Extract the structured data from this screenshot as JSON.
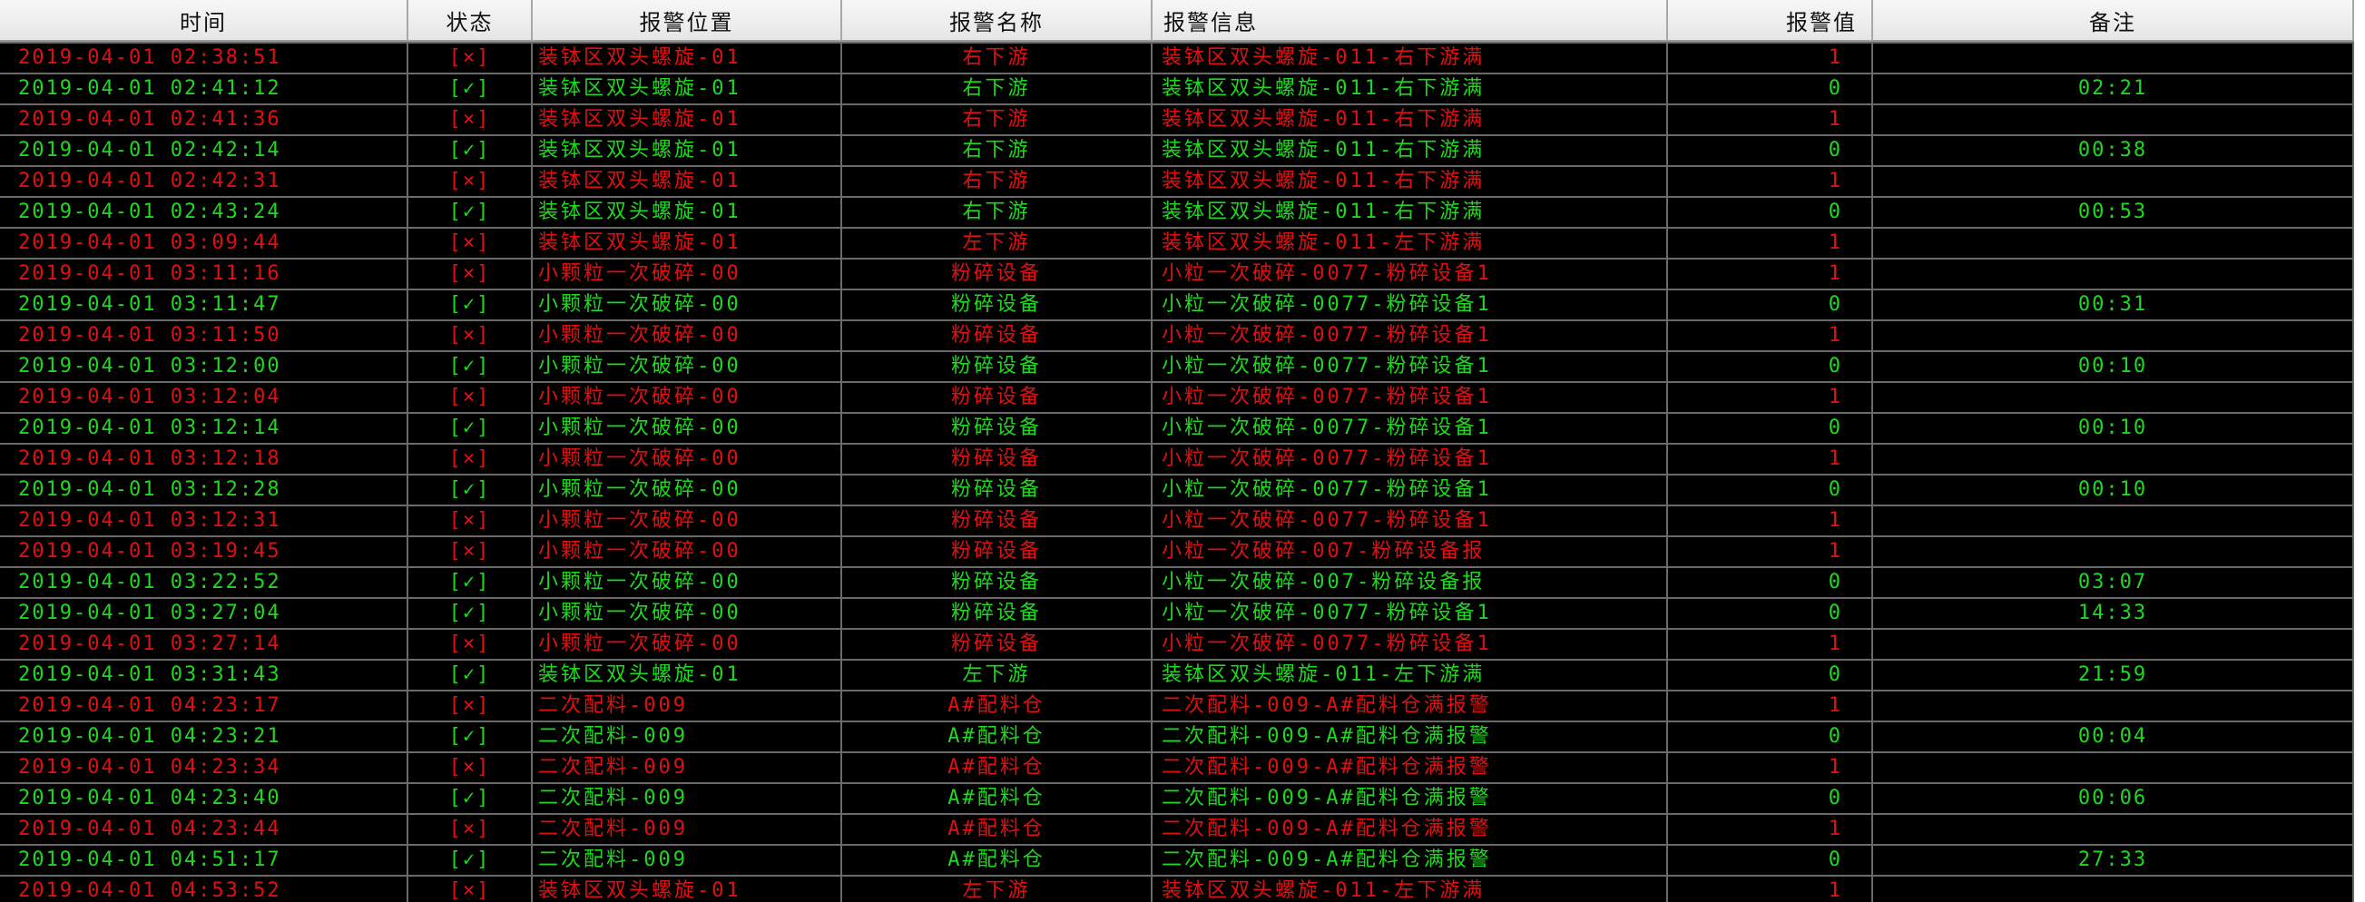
{
  "headers": [
    "时间",
    "状态",
    "报警位置",
    "报警名称",
    "报警信息",
    "报警值",
    "备注"
  ],
  "colors": {
    "alarm": "#e01010",
    "recovered": "#1fd81f"
  },
  "rows": [
    {
      "time": "2019-04-01  02:38:51",
      "status": "[×]",
      "location": "装钵区双头螺旋-01",
      "name": "右下游",
      "info": "装钵区双头螺旋-011-右下游满",
      "value": "1",
      "note": "",
      "state": "alarm"
    },
    {
      "time": "2019-04-01  02:41:12",
      "status": "[✓]",
      "location": "装钵区双头螺旋-01",
      "name": "右下游",
      "info": "装钵区双头螺旋-011-右下游满",
      "value": "0",
      "note": "02:21",
      "state": "recovered"
    },
    {
      "time": "2019-04-01  02:41:36",
      "status": "[×]",
      "location": "装钵区双头螺旋-01",
      "name": "右下游",
      "info": "装钵区双头螺旋-011-右下游满",
      "value": "1",
      "note": "",
      "state": "alarm"
    },
    {
      "time": "2019-04-01  02:42:14",
      "status": "[✓]",
      "location": "装钵区双头螺旋-01",
      "name": "右下游",
      "info": "装钵区双头螺旋-011-右下游满",
      "value": "0",
      "note": "00:38",
      "state": "recovered"
    },
    {
      "time": "2019-04-01  02:42:31",
      "status": "[×]",
      "location": "装钵区双头螺旋-01",
      "name": "右下游",
      "info": "装钵区双头螺旋-011-右下游满",
      "value": "1",
      "note": "",
      "state": "alarm"
    },
    {
      "time": "2019-04-01  02:43:24",
      "status": "[✓]",
      "location": "装钵区双头螺旋-01",
      "name": "右下游",
      "info": "装钵区双头螺旋-011-右下游满",
      "value": "0",
      "note": "00:53",
      "state": "recovered"
    },
    {
      "time": "2019-04-01  03:09:44",
      "status": "[×]",
      "location": "装钵区双头螺旋-01",
      "name": "左下游",
      "info": "装钵区双头螺旋-011-左下游满",
      "value": "1",
      "note": "",
      "state": "alarm"
    },
    {
      "time": "2019-04-01  03:11:16",
      "status": "[×]",
      "location": "小颗粒一次破碎-00",
      "name": "粉碎设备",
      "info": "小粒一次破碎-0077-粉碎设备1",
      "value": "1",
      "note": "",
      "state": "alarm"
    },
    {
      "time": "2019-04-01  03:11:47",
      "status": "[✓]",
      "location": "小颗粒一次破碎-00",
      "name": "粉碎设备",
      "info": "小粒一次破碎-0077-粉碎设备1",
      "value": "0",
      "note": "00:31",
      "state": "recovered"
    },
    {
      "time": "2019-04-01  03:11:50",
      "status": "[×]",
      "location": "小颗粒一次破碎-00",
      "name": "粉碎设备",
      "info": "小粒一次破碎-0077-粉碎设备1",
      "value": "1",
      "note": "",
      "state": "alarm"
    },
    {
      "time": "2019-04-01  03:12:00",
      "status": "[✓]",
      "location": "小颗粒一次破碎-00",
      "name": "粉碎设备",
      "info": "小粒一次破碎-0077-粉碎设备1",
      "value": "0",
      "note": "00:10",
      "state": "recovered"
    },
    {
      "time": "2019-04-01  03:12:04",
      "status": "[×]",
      "location": "小颗粒一次破碎-00",
      "name": "粉碎设备",
      "info": "小粒一次破碎-0077-粉碎设备1",
      "value": "1",
      "note": "",
      "state": "alarm"
    },
    {
      "time": "2019-04-01  03:12:14",
      "status": "[✓]",
      "location": "小颗粒一次破碎-00",
      "name": "粉碎设备",
      "info": "小粒一次破碎-0077-粉碎设备1",
      "value": "0",
      "note": "00:10",
      "state": "recovered"
    },
    {
      "time": "2019-04-01  03:12:18",
      "status": "[×]",
      "location": "小颗粒一次破碎-00",
      "name": "粉碎设备",
      "info": "小粒一次破碎-0077-粉碎设备1",
      "value": "1",
      "note": "",
      "state": "alarm"
    },
    {
      "time": "2019-04-01  03:12:28",
      "status": "[✓]",
      "location": "小颗粒一次破碎-00",
      "name": "粉碎设备",
      "info": "小粒一次破碎-0077-粉碎设备1",
      "value": "0",
      "note": "00:10",
      "state": "recovered"
    },
    {
      "time": "2019-04-01  03:12:31",
      "status": "[×]",
      "location": "小颗粒一次破碎-00",
      "name": "粉碎设备",
      "info": "小粒一次破碎-0077-粉碎设备1",
      "value": "1",
      "note": "",
      "state": "alarm"
    },
    {
      "time": "2019-04-01  03:19:45",
      "status": "[×]",
      "location": "小颗粒一次破碎-00",
      "name": "粉碎设备",
      "info": "小粒一次破碎-007-粉碎设备报",
      "value": "1",
      "note": "",
      "state": "alarm"
    },
    {
      "time": "2019-04-01  03:22:52",
      "status": "[✓]",
      "location": "小颗粒一次破碎-00",
      "name": "粉碎设备",
      "info": "小粒一次破碎-007-粉碎设备报",
      "value": "0",
      "note": "03:07",
      "state": "recovered"
    },
    {
      "time": "2019-04-01  03:27:04",
      "status": "[✓]",
      "location": "小颗粒一次破碎-00",
      "name": "粉碎设备",
      "info": "小粒一次破碎-0077-粉碎设备1",
      "value": "0",
      "note": "14:33",
      "state": "recovered"
    },
    {
      "time": "2019-04-01  03:27:14",
      "status": "[×]",
      "location": "小颗粒一次破碎-00",
      "name": "粉碎设备",
      "info": "小粒一次破碎-0077-粉碎设备1",
      "value": "1",
      "note": "",
      "state": "alarm"
    },
    {
      "time": "2019-04-01  03:31:43",
      "status": "[✓]",
      "location": "装钵区双头螺旋-01",
      "name": "左下游",
      "info": "装钵区双头螺旋-011-左下游满",
      "value": "0",
      "note": "21:59",
      "state": "recovered"
    },
    {
      "time": "2019-04-01  04:23:17",
      "status": "[×]",
      "location": "二次配料-009",
      "name": "A#配料仓",
      "info": "二次配料-009-A#配料仓满报警",
      "value": "1",
      "note": "",
      "state": "alarm"
    },
    {
      "time": "2019-04-01  04:23:21",
      "status": "[✓]",
      "location": "二次配料-009",
      "name": "A#配料仓",
      "info": "二次配料-009-A#配料仓满报警",
      "value": "0",
      "note": "00:04",
      "state": "recovered"
    },
    {
      "time": "2019-04-01  04:23:34",
      "status": "[×]",
      "location": "二次配料-009",
      "name": "A#配料仓",
      "info": "二次配料-009-A#配料仓满报警",
      "value": "1",
      "note": "",
      "state": "alarm"
    },
    {
      "time": "2019-04-01  04:23:40",
      "status": "[✓]",
      "location": "二次配料-009",
      "name": "A#配料仓",
      "info": "二次配料-009-A#配料仓满报警",
      "value": "0",
      "note": "00:06",
      "state": "recovered"
    },
    {
      "time": "2019-04-01  04:23:44",
      "status": "[×]",
      "location": "二次配料-009",
      "name": "A#配料仓",
      "info": "二次配料-009-A#配料仓满报警",
      "value": "1",
      "note": "",
      "state": "alarm"
    },
    {
      "time": "2019-04-01  04:51:17",
      "status": "[✓]",
      "location": "二次配料-009",
      "name": "A#配料仓",
      "info": "二次配料-009-A#配料仓满报警",
      "value": "0",
      "note": "27:33",
      "state": "recovered"
    },
    {
      "time": "2019-04-01  04:53:52",
      "status": "[×]",
      "location": "装钵区双头螺旋-01",
      "name": "左下游",
      "info": "装钵区双头螺旋-011-左下游满",
      "value": "1",
      "note": "",
      "state": "alarm"
    }
  ]
}
